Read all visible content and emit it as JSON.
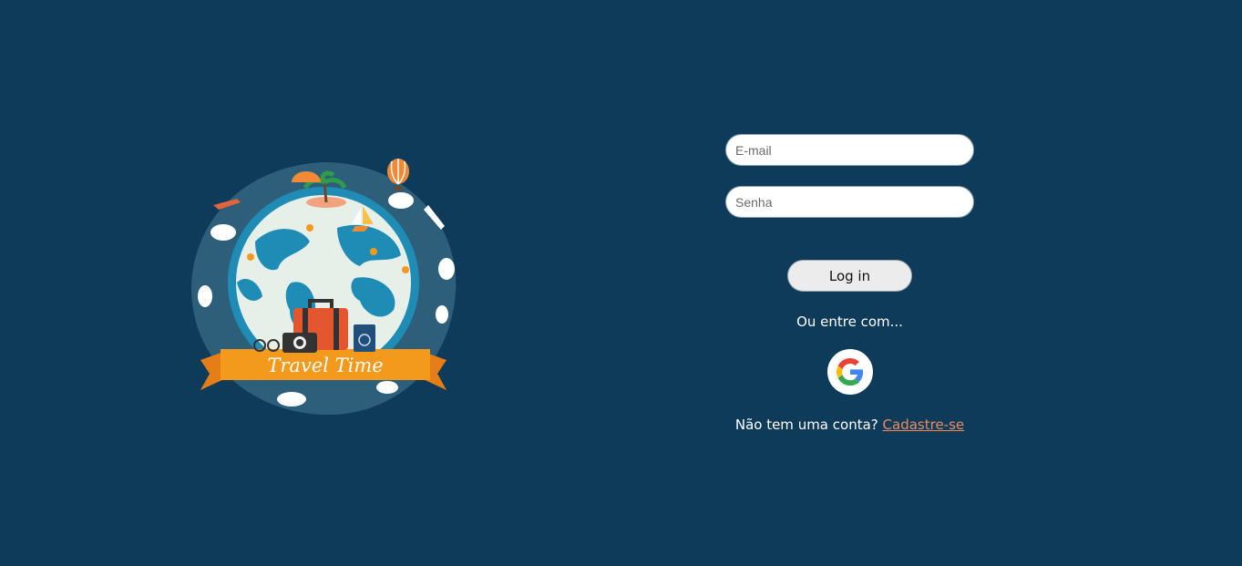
{
  "colors": {
    "background": "#0f3b5a",
    "accent": "#f08a5d"
  },
  "logo": {
    "text": "Travel Time",
    "icon": "globe-travel-logo"
  },
  "form": {
    "email_placeholder": "E-mail",
    "password_placeholder": "Senha",
    "login_label": "Log in",
    "or_text": "Ou entre com...",
    "google_icon": "google-icon",
    "signup_prompt": "Não tem uma conta?",
    "signup_link": "Cadastre-se"
  }
}
